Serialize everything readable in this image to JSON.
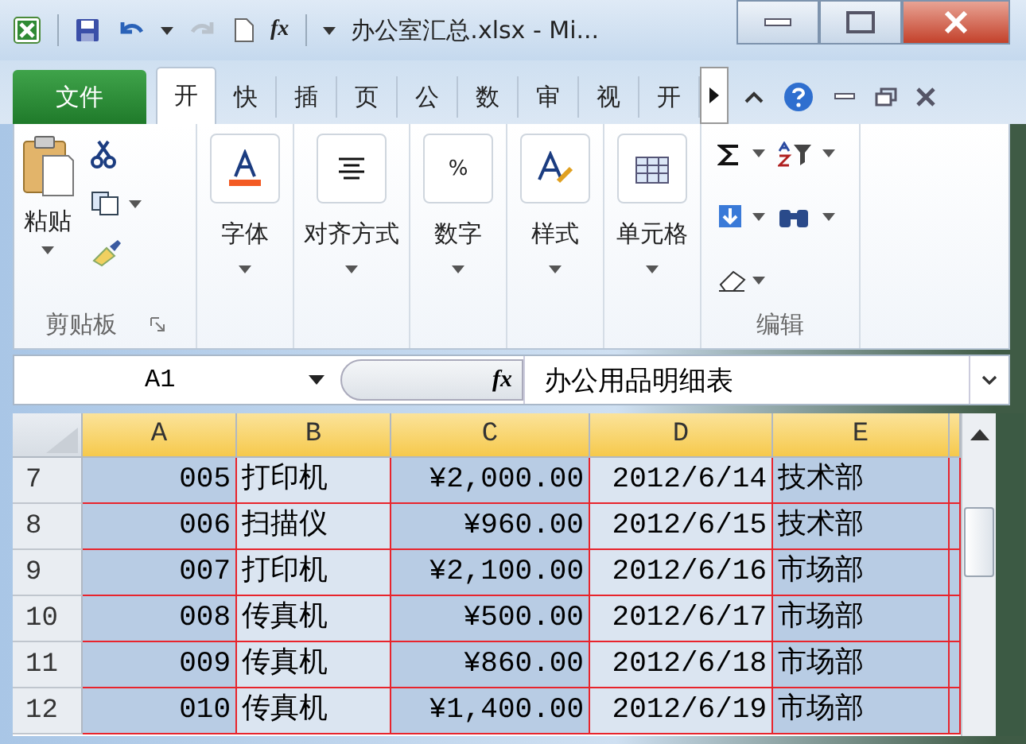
{
  "window": {
    "title": "办公室汇总.xlsx - Mi...",
    "function_glyph": "fx"
  },
  "ribbon_tabs": [
    {
      "label": "文件",
      "kind": "file",
      "selected": false
    },
    {
      "label": "开",
      "kind": "tab",
      "selected": true
    },
    {
      "label": "快",
      "kind": "tab",
      "selected": false
    },
    {
      "label": "插",
      "kind": "tab",
      "selected": false
    },
    {
      "label": "页",
      "kind": "tab",
      "selected": false
    },
    {
      "label": "公",
      "kind": "tab",
      "selected": false
    },
    {
      "label": "数",
      "kind": "tab",
      "selected": false
    },
    {
      "label": "审",
      "kind": "tab",
      "selected": false
    },
    {
      "label": "视",
      "kind": "tab",
      "selected": false
    },
    {
      "label": "开",
      "kind": "tab",
      "selected": false
    }
  ],
  "ribbon_groups": [
    {
      "kind": "clipboard",
      "label": "剪贴板",
      "paste_label": "粘贴"
    },
    {
      "kind": "collapsed",
      "label": "字体"
    },
    {
      "kind": "collapsed",
      "label": "对齐方式"
    },
    {
      "kind": "collapsed",
      "icon_text": "%",
      "label": "数字"
    },
    {
      "kind": "collapsed",
      "label": "样式"
    },
    {
      "kind": "collapsed",
      "label": "单元格"
    },
    {
      "kind": "editing",
      "label": "编辑"
    }
  ],
  "formula_bar": {
    "name_box": "A1",
    "function_glyph": "fx",
    "content": "办公用品明细表"
  },
  "sheet": {
    "columns": [
      {
        "label": "A",
        "kind": "number",
        "selected": true
      },
      {
        "label": "B",
        "kind": "text",
        "selected": true
      },
      {
        "label": "C",
        "kind": "number",
        "selected": true
      },
      {
        "label": "D",
        "kind": "number",
        "selected": true
      },
      {
        "label": "E",
        "kind": "text",
        "selected": true
      }
    ],
    "rows": [
      {
        "number": "7",
        "cells": [
          "005",
          "打印机",
          "¥2,000.00",
          "2012/6/14",
          "技术部"
        ]
      },
      {
        "number": "8",
        "cells": [
          "006",
          "扫描仪",
          "¥960.00",
          "2012/6/15",
          "技术部"
        ]
      },
      {
        "number": "9",
        "cells": [
          "007",
          "打印机",
          "¥2,100.00",
          "2012/6/16",
          "市场部"
        ]
      },
      {
        "number": "10",
        "cells": [
          "008",
          "传真机",
          "¥500.00",
          "2012/6/17",
          "市场部"
        ]
      },
      {
        "number": "11",
        "cells": [
          "009",
          "传真机",
          "¥860.00",
          "2012/6/18",
          "市场部"
        ]
      },
      {
        "number": "12",
        "cells": [
          "010",
          "传真机",
          "¥1,400.00",
          "2012/6/19",
          "市场部"
        ]
      }
    ]
  }
}
